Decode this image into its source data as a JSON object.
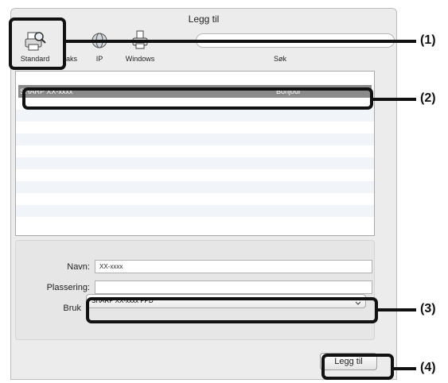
{
  "window": {
    "title": "Legg til"
  },
  "toolbar": {
    "items": [
      {
        "label": "Standard",
        "icon": "printer-magnifier-icon"
      },
      {
        "label": "aks",
        "icon": "fax-icon"
      },
      {
        "label": "IP",
        "icon": "globe-icon"
      },
      {
        "label": "Windows",
        "icon": "windows-printer-icon"
      }
    ],
    "search_label": "Søk"
  },
  "printer_list": {
    "rows": [
      {
        "name": "SHARP XX-xxxx",
        "kind": "Bonjour"
      }
    ]
  },
  "form": {
    "name_label": "Navn:",
    "name_value": "XX-xxxx",
    "location_label": "Plassering:",
    "location_value": "",
    "use_label": "Bruk",
    "use_value": "SHARP XX-xxxx PPD"
  },
  "add_button": {
    "label": "Legg til"
  },
  "callouts": [
    "(1)",
    "(2)",
    "(3)",
    "(4)"
  ],
  "colors": {
    "highlight": "#111111",
    "selection": "#8a8a8a"
  }
}
